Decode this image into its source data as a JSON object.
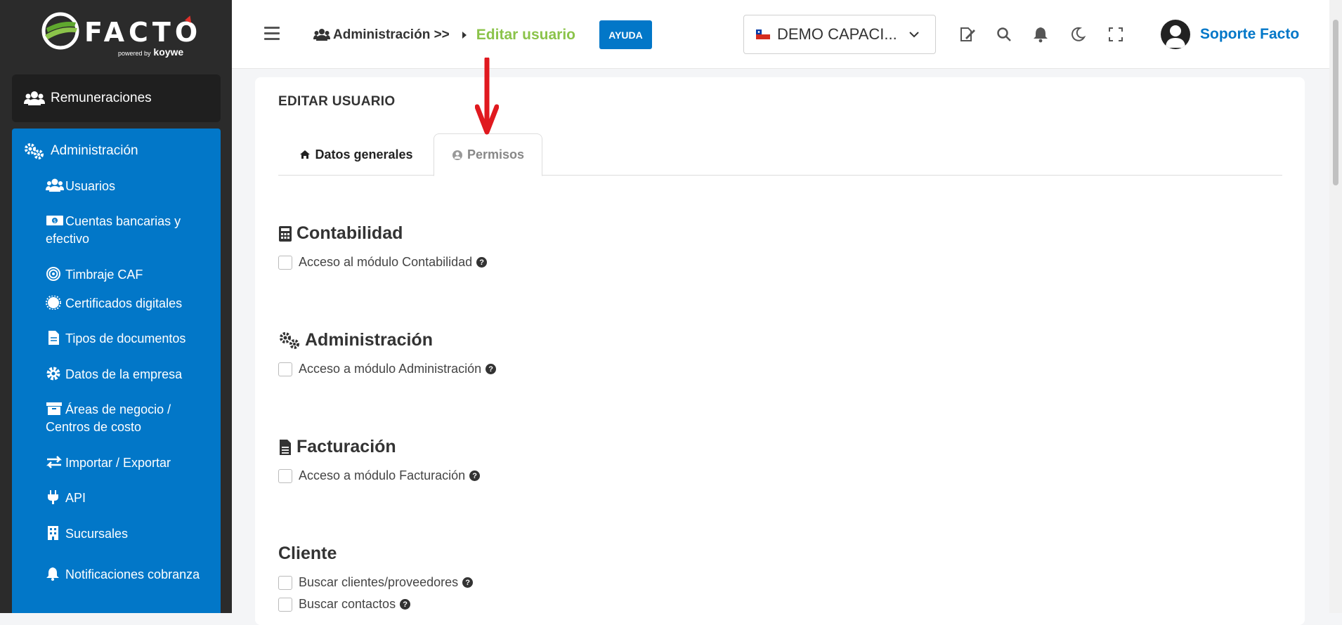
{
  "brand": {
    "name": "FACTO",
    "powered_by": "powered by",
    "partner": "koywe"
  },
  "sidebar": {
    "remuneraciones": "Remuneraciones",
    "admin_label": "Administración",
    "items": [
      {
        "label": "Usuarios"
      },
      {
        "label": "Cuentas bancarias y efectivo"
      },
      {
        "label": "Timbraje CAF"
      },
      {
        "label": "Certificados digitales"
      },
      {
        "label": "Tipos de documentos"
      },
      {
        "label": "Datos de la empresa"
      },
      {
        "label": "Áreas de negocio / Centros de costo"
      },
      {
        "label": "Importar / Exportar"
      },
      {
        "label": "API"
      },
      {
        "label": "Sucursales"
      },
      {
        "label": "Notificaciones cobranza"
      }
    ]
  },
  "header": {
    "breadcrumb_parent": "Administración >>",
    "breadcrumb_current": "Editar usuario",
    "help_label": "AYUDA",
    "company_selected": "DEMO CAPACI...",
    "user_name": "Soporte Facto"
  },
  "main": {
    "title": "EDITAR USUARIO",
    "tabs": [
      {
        "label": "Datos generales"
      },
      {
        "label": "Permisos"
      }
    ],
    "sections": [
      {
        "title": "Contabilidad",
        "perms": [
          "Acceso al módulo Contabilidad"
        ]
      },
      {
        "title": "Administración",
        "perms": [
          "Acceso a módulo Administración"
        ]
      },
      {
        "title": "Facturación",
        "perms": [
          "Acceso a módulo Facturación"
        ]
      },
      {
        "title": "Cliente",
        "perms": [
          "Buscar clientes/proveedores",
          "Buscar contactos"
        ]
      }
    ],
    "help_glyph": "?"
  },
  "colors": {
    "primary": "#0277c8",
    "accent_green": "#8bc34a",
    "sidebar_bg": "#2b2b2b",
    "annotation_arrow": "#e0191f"
  }
}
